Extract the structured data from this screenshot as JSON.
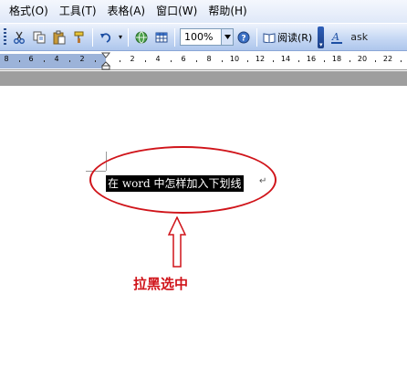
{
  "menu": {
    "items": [
      {
        "label": "格式(O)",
        "name": "menu-format"
      },
      {
        "label": "工具(T)",
        "name": "menu-tools"
      },
      {
        "label": "表格(A)",
        "name": "menu-table"
      },
      {
        "label": "窗口(W)",
        "name": "menu-window"
      },
      {
        "label": "帮助(H)",
        "name": "menu-help"
      }
    ]
  },
  "toolbar": {
    "zoom_value": "100%",
    "read_label": "阅读(R)",
    "ask_text": "ask",
    "icons": [
      "cut-icon",
      "copy-icon",
      "paste-icon",
      "format-painter-icon",
      "undo-icon",
      "hyperlink-icon",
      "table-icon",
      "help-icon",
      "reading-icon",
      "font-color-icon"
    ]
  },
  "ruler": {
    "left_numbers": [
      "8",
      "6",
      "4",
      "2"
    ],
    "right_numbers": [
      "2",
      "4",
      "6",
      "8",
      "10",
      "12",
      "14",
      "16",
      "18",
      "20",
      "22"
    ]
  },
  "document": {
    "selected_text": "在 word 中怎样加入下划线",
    "paragraph_mark": "↵"
  },
  "annotation": {
    "caption": "拉黑选中",
    "color": "#d0141a"
  }
}
